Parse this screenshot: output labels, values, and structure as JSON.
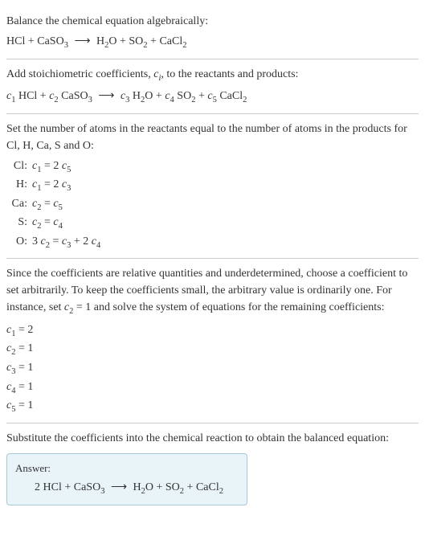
{
  "section1": {
    "title": "Balance the chemical equation algebraically:",
    "eq_pre": "HCl + CaSO",
    "eq_sub1": "3",
    "eq_arrow": "⟶",
    "eq_mid1": "H",
    "eq_sub2": "2",
    "eq_mid2": "O + SO",
    "eq_sub3": "2",
    "eq_mid3": " + CaCl",
    "eq_sub4": "2"
  },
  "section2": {
    "title_pre": "Add stoichiometric coefficients, ",
    "title_c": "c",
    "title_i": "i",
    "title_post": ", to the reactants and products:",
    "c1": "c",
    "n1": "1",
    "t1": " HCl + ",
    "c2": "c",
    "n2": "2",
    "t2": " CaSO",
    "s2": "3",
    "arrow": "⟶",
    "c3": "c",
    "n3": "3",
    "t3": " H",
    "s3": "2",
    "t3b": "O + ",
    "c4": "c",
    "n4": "4",
    "t4": " SO",
    "s4": "2",
    "t4b": " + ",
    "c5": "c",
    "n5": "5",
    "t5": " CaCl",
    "s5": "2"
  },
  "section3": {
    "title": "Set the number of atoms in the reactants equal to the number of atoms in the products for Cl, H, Ca, S and O:",
    "rows": [
      {
        "label": "Cl:",
        "c_a": "c",
        "n_a": "1",
        "op": " = 2 ",
        "c_b": "c",
        "n_b": "5",
        "rest": ""
      },
      {
        "label": "H:",
        "c_a": "c",
        "n_a": "1",
        "op": " = 2 ",
        "c_b": "c",
        "n_b": "3",
        "rest": ""
      },
      {
        "label": "Ca:",
        "c_a": "c",
        "n_a": "2",
        "op": " = ",
        "c_b": "c",
        "n_b": "5",
        "rest": ""
      },
      {
        "label": "S:",
        "c_a": "c",
        "n_a": "2",
        "op": " = ",
        "c_b": "c",
        "n_b": "4",
        "rest": ""
      }
    ],
    "row5": {
      "label": "O:",
      "pre": "3 ",
      "c1": "c",
      "n1": "2",
      "mid1": " = ",
      "c2": "c",
      "n2": "3",
      "mid2": " + 2 ",
      "c3": "c",
      "n3": "4"
    }
  },
  "section4": {
    "title_pre": "Since the coefficients are relative quantities and underdetermined, choose a coefficient to set arbitrarily. To keep the coefficients small, the arbitrary value is ordinarily one. For instance, set ",
    "title_c": "c",
    "title_n": "2",
    "title_post": " = 1 and solve the system of equations for the remaining coefficients:",
    "coefs": [
      {
        "c": "c",
        "n": "1",
        "val": " = 2"
      },
      {
        "c": "c",
        "n": "2",
        "val": " = 1"
      },
      {
        "c": "c",
        "n": "3",
        "val": " = 1"
      },
      {
        "c": "c",
        "n": "4",
        "val": " = 1"
      },
      {
        "c": "c",
        "n": "5",
        "val": " = 1"
      }
    ]
  },
  "section5": {
    "title": "Substitute the coefficients into the chemical reaction to obtain the balanced equation:",
    "answer_label": "Answer:",
    "eq_pre": "2 HCl + CaSO",
    "eq_sub1": "3",
    "eq_arrow": "⟶",
    "eq_mid1": "H",
    "eq_sub2": "2",
    "eq_mid2": "O + SO",
    "eq_sub3": "2",
    "eq_mid3": " + CaCl",
    "eq_sub4": "2"
  }
}
